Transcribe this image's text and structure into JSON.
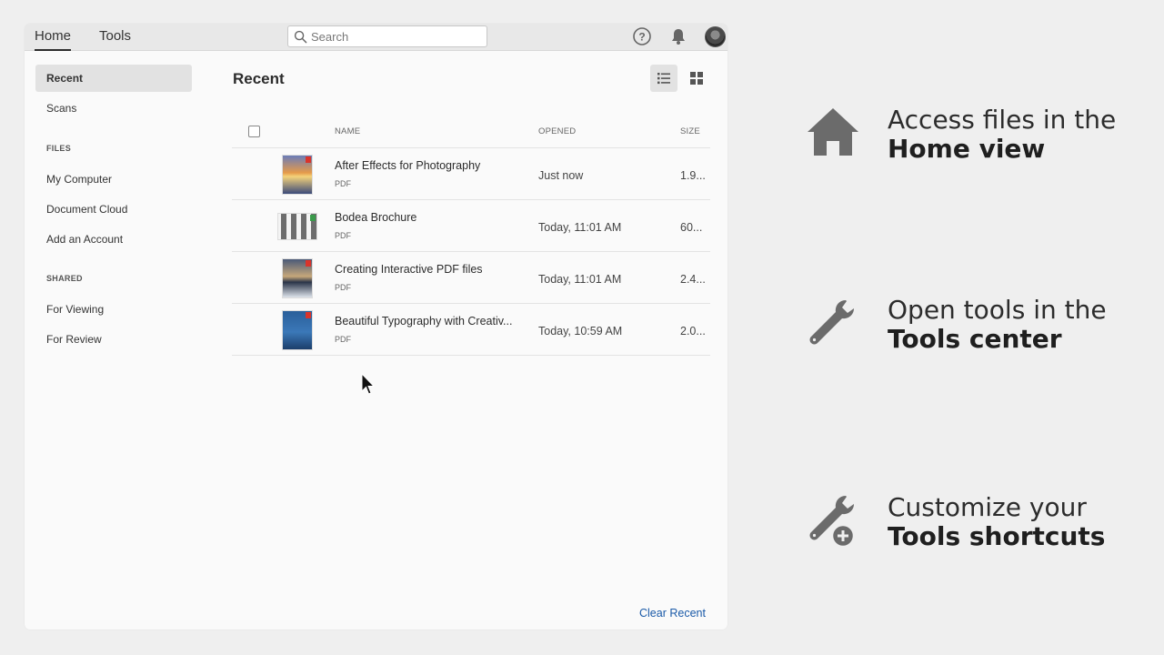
{
  "app": {
    "tabs": {
      "home": "Home",
      "tools": "Tools"
    },
    "search": {
      "placeholder": "Search",
      "value": ""
    },
    "icons": [
      "help-icon",
      "bell-icon",
      "avatar"
    ]
  },
  "sidebar": {
    "items_top": [
      {
        "label": "Recent",
        "active": true
      },
      {
        "label": "Scans"
      }
    ],
    "files_header": "FILES",
    "files_items": [
      {
        "label": "My Computer"
      },
      {
        "label": "Document Cloud"
      },
      {
        "label": "Add an Account"
      }
    ],
    "shared_header": "SHARED",
    "shared_items": [
      {
        "label": "For Viewing"
      },
      {
        "label": "For Review"
      }
    ]
  },
  "main": {
    "title": "Recent",
    "columns": {
      "name": "NAME",
      "opened": "OPENED",
      "size": "SIZE"
    },
    "files": [
      {
        "name": "After Effects for Photography",
        "type": "PDF",
        "opened": "Just now",
        "size": "1.9..."
      },
      {
        "name": "Bodea Brochure",
        "type": "PDF",
        "opened": "Today, 11:01 AM",
        "size": "60..."
      },
      {
        "name": "Creating Interactive PDF files",
        "type": "PDF",
        "opened": "Today, 11:01 AM",
        "size": "2.4..."
      },
      {
        "name": "Beautiful Typography with Creativ...",
        "type": "PDF",
        "opened": "Today, 10:59 AM",
        "size": "2.0..."
      }
    ],
    "clear_label": "Clear Recent"
  },
  "features": [
    {
      "line1": "Access files in the",
      "line2": "Home view",
      "icon": "home-icon"
    },
    {
      "line1": "Open tools in the",
      "line2": "Tools center",
      "icon": "wrench-icon"
    },
    {
      "line1": "Customize your",
      "line2": "Tools shortcuts",
      "icon": "wrench-plus-icon"
    }
  ],
  "colors": {
    "accent_link": "#1a5aa8",
    "pdf_badge": "#d9342b",
    "icon_gray": "#6b6b6b"
  }
}
